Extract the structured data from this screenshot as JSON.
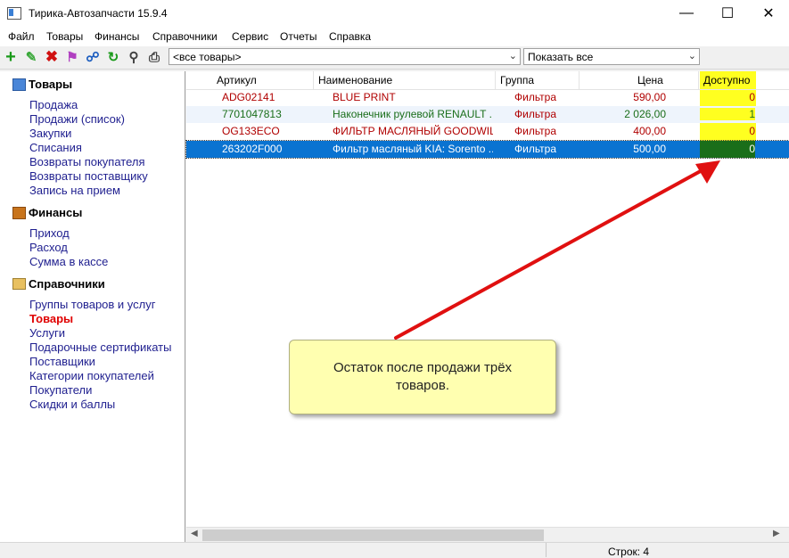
{
  "window": {
    "title": "Тирика-Автозапчасти 15.9.4"
  },
  "menu": [
    "Файл",
    "Товары",
    "Финансы",
    "Справочники",
    "Сервис",
    "Отчеты",
    "Справка"
  ],
  "toolbar": {
    "filter_combo": "<все товары>",
    "show_combo": "Показать все"
  },
  "sidebar": {
    "sections": [
      {
        "title": "Товары",
        "items": [
          "Продажа",
          "Продажи (список)",
          "Закупки",
          "Списания",
          "Возвраты покупателя",
          "Возвраты поставщику",
          "Запись на прием"
        ]
      },
      {
        "title": "Финансы",
        "items": [
          "Приход",
          "Расход",
          "Сумма в кассе"
        ]
      },
      {
        "title": "Справочники",
        "items": [
          "Группы товаров и услуг",
          "Товары",
          "Услуги",
          "Подарочные сертификаты",
          "Поставщики",
          "Категории покупателей",
          "Покупатели",
          "Скидки и баллы"
        ]
      }
    ],
    "active_item": "Товары"
  },
  "table": {
    "columns": [
      "Артикул",
      "Наименование",
      "Группа",
      "Цена",
      "Доступно"
    ],
    "rows": [
      {
        "article": "ADG02141",
        "name": "BLUE PRINT",
        "group": "Фильтра",
        "price": "590,00",
        "available": "0",
        "color": "#b00000"
      },
      {
        "article": "7701047813",
        "name": "Наконечник рулевой RENAULT ...",
        "group": "Фильтра",
        "price": "2 026,00",
        "available": "1",
        "color": "#1a6e1a"
      },
      {
        "article": "OG133ECO",
        "name": "ФИЛЬТР МАСЛЯНЫЙ GOODWILL",
        "group": "Фильтра",
        "price": "400,00",
        "available": "0",
        "color": "#b00000"
      },
      {
        "article": "263202F000",
        "name": "Фильтр масляный KIA: Sorento ...",
        "group": "Фильтра",
        "price": "500,00",
        "available": "0",
        "color": "#ffffff"
      }
    ],
    "selected_row": 3
  },
  "callout": {
    "line1": "Остаток после продажи трёх",
    "line2": "товаров."
  },
  "status": {
    "rows_count": "Строк: 4"
  },
  "colors": {
    "highlight": "#ffff20",
    "selection": "#0a73d1",
    "arrow": "#e01010"
  }
}
